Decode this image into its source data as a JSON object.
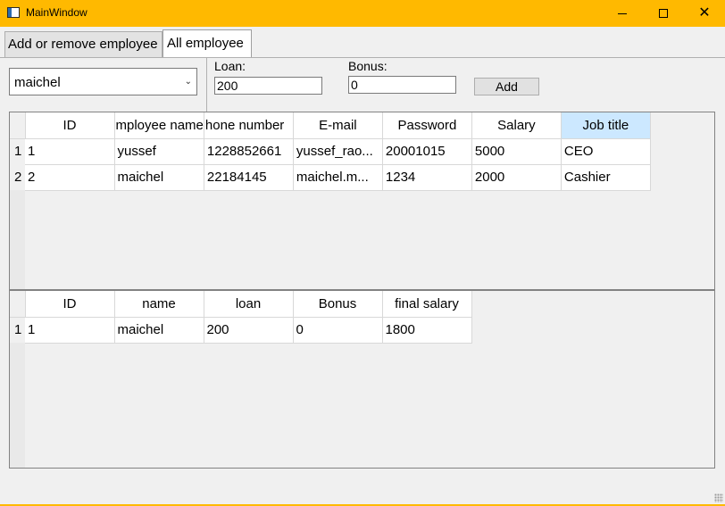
{
  "window": {
    "title": "MainWindow"
  },
  "tabs": [
    {
      "label": "Add or remove employee"
    },
    {
      "label": "All employee"
    }
  ],
  "form": {
    "employee_select": "maichel",
    "loan_label": "Loan:",
    "loan_value": "200",
    "bonus_label": "Bonus:",
    "bonus_value": "0",
    "add_label": "Add"
  },
  "employees_table": {
    "columns": [
      "ID",
      "Employee name",
      "Phone number",
      "E-mail",
      "Password",
      "Salary",
      "Job title"
    ],
    "rows": [
      {
        "header": "1",
        "cells": [
          "1",
          "yussef",
          "1228852661",
          "yussef_rao...",
          "20001015",
          "5000",
          "CEO"
        ]
      },
      {
        "header": "2",
        "cells": [
          "2",
          "maichel",
          "22184145",
          "maichel.m...",
          "1234",
          "2000",
          "Cashier"
        ]
      }
    ]
  },
  "salary_table": {
    "columns": [
      "ID",
      "name",
      "loan",
      "Bonus",
      "final salary"
    ],
    "rows": [
      {
        "header": "1",
        "cells": [
          "1",
          "maichel",
          "200",
          "0",
          "1800"
        ]
      }
    ]
  },
  "colors": {
    "titlebar": "#ffb900",
    "selected_header": "#cce8ff"
  }
}
